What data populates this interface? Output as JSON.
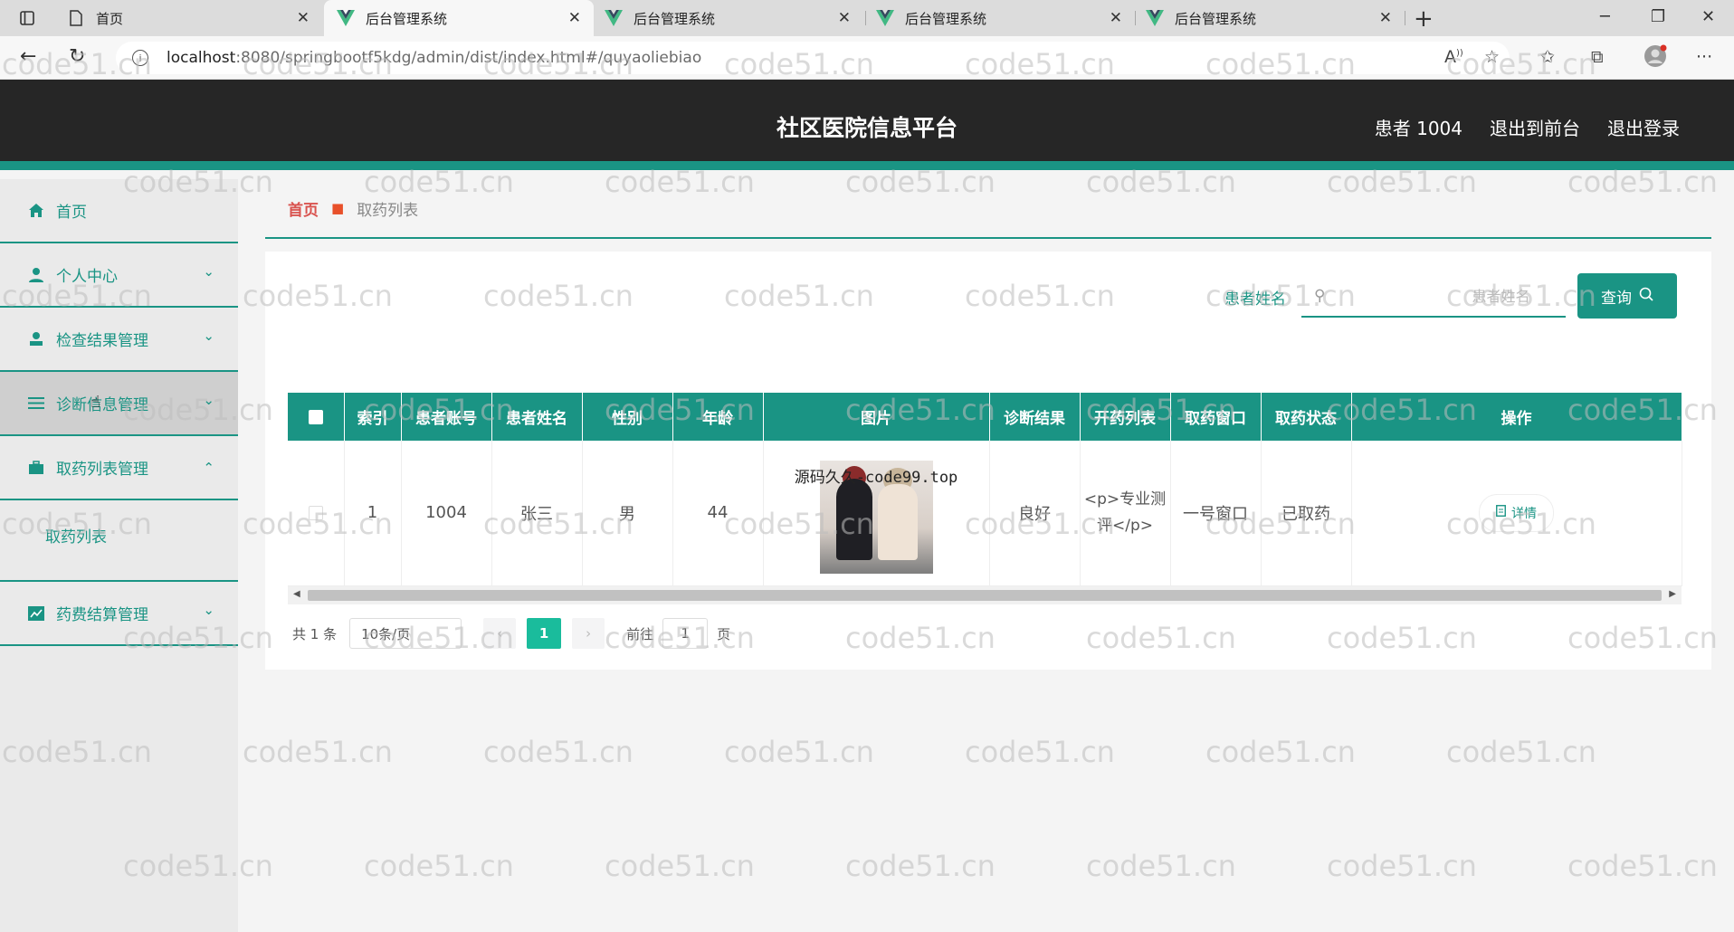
{
  "browser": {
    "tabs": [
      {
        "title": "首页",
        "active": false
      },
      {
        "title": "后台管理系统",
        "active": true
      },
      {
        "title": "后台管理系统",
        "active": false
      },
      {
        "title": "后台管理系统",
        "active": false
      },
      {
        "title": "后台管理系统",
        "active": false
      }
    ],
    "url_host": "localhost",
    "url_path": ":8080/springbootf5kdg/admin/dist/index.html#/quyaoliebiao"
  },
  "header": {
    "title": "社区医院信息平台",
    "user": "患者 1004",
    "to_front": "退出到前台",
    "logout": "退出登录"
  },
  "sidebar": {
    "items": [
      {
        "label": "首页",
        "icon": "home-icon"
      },
      {
        "label": "个人中心",
        "icon": "user-icon",
        "chevron": "down"
      },
      {
        "label": "检查结果管理",
        "icon": "user-stamp-icon",
        "chevron": "down"
      },
      {
        "label": "诊断信息管理",
        "icon": "list-icon",
        "chevron": "down"
      },
      {
        "label": "取药列表管理",
        "icon": "briefcase-icon",
        "chevron": "up"
      },
      {
        "label": "药费结算管理",
        "icon": "chart-icon",
        "chevron": "down"
      }
    ],
    "submenu": "取药列表"
  },
  "breadcrumb": {
    "home": "首页",
    "current": "取药列表"
  },
  "search": {
    "label": "患者姓名",
    "placeholder": "患者姓名",
    "button": "查询"
  },
  "table": {
    "headers": [
      "索引",
      "患者账号",
      "患者姓名",
      "性别",
      "年龄",
      "图片",
      "诊断结果",
      "开药列表",
      "取药窗口",
      "取药状态",
      "操作"
    ],
    "rows": [
      {
        "index": "1",
        "account": "1004",
        "name": "张三",
        "gender": "男",
        "age": "44",
        "image_caption": "源码久久-code99.top",
        "diagnosis": "良好",
        "prescription": "<p>专业测评</p>",
        "window": "一号窗口",
        "status": "已取药",
        "action": "详情"
      }
    ]
  },
  "pagination": {
    "total": "共 1 条",
    "page_size": "10条/页",
    "current": "1",
    "goto_label": "前往",
    "goto_value": "1",
    "page_suffix": "页"
  },
  "watermark": "code51.cn",
  "colors": {
    "accent": "#1a9484",
    "header_bg": "#262626",
    "page_active": "#1abc9c"
  }
}
